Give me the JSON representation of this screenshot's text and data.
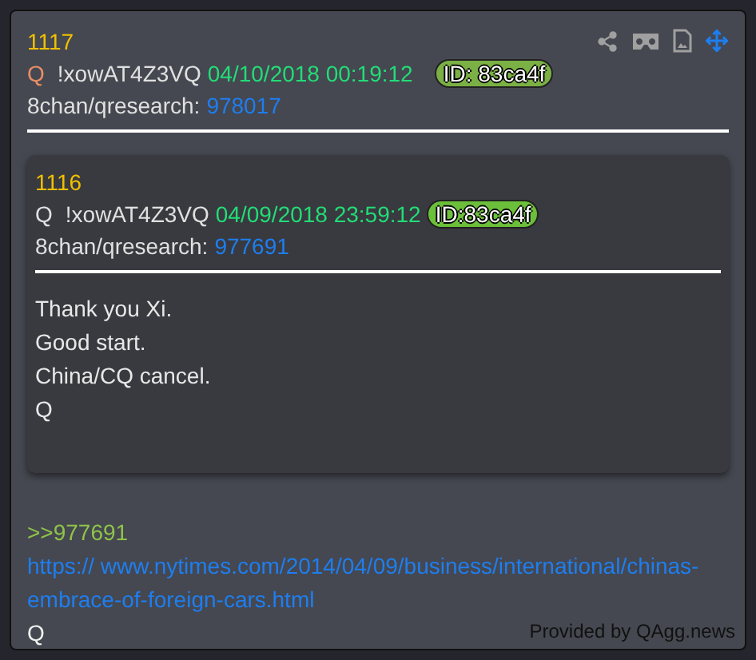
{
  "post": {
    "number": "1117",
    "author": "Q",
    "trip": "!xowAT4Z3VQ",
    "timestamp": "04/10/2018 00:19:12",
    "id": "ID: 83ca4f",
    "board": "8chan/qresearch:",
    "post_id": "978017",
    "toolbar": [
      {
        "kind": "share"
      },
      {
        "kind": "headset"
      },
      {
        "kind": "document"
      },
      {
        "kind": "move"
      }
    ],
    "quoted": {
      "number": "1116",
      "author": "Q",
      "trip": "!xowAT4Z3VQ",
      "timestamp": "04/09/2018 23:59:12",
      "id": "ID:83ca4f",
      "board": "8chan/qresearch:",
      "post_id": "977691",
      "lines": [
        "Thank you Xi.",
        "Good start.",
        "China/CQ cancel.",
        "Q"
      ]
    },
    "reply_ref": ">>977691",
    "link": "https:// www.nytimes.com/2014/04/09/business/international/chinas-embrace-of-foreign-cars.html",
    "signature": "Q"
  },
  "credit": "Provided by QAgg.news"
}
